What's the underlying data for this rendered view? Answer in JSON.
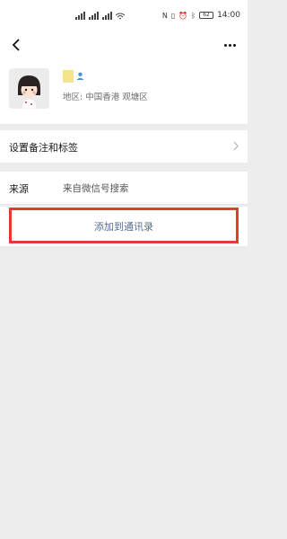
{
  "status_bar": {
    "battery": "62",
    "time": "14:00"
  },
  "profile": {
    "region": "地区: 中国香港  观塘区"
  },
  "rows": {
    "remark_label": "设置备注和标签",
    "source_label": "来源",
    "source_value": "来自微信号搜索"
  },
  "actions": {
    "add_contact": "添加到通讯录"
  },
  "colors": {
    "link": "#576b95",
    "highlight": "#e53935"
  }
}
